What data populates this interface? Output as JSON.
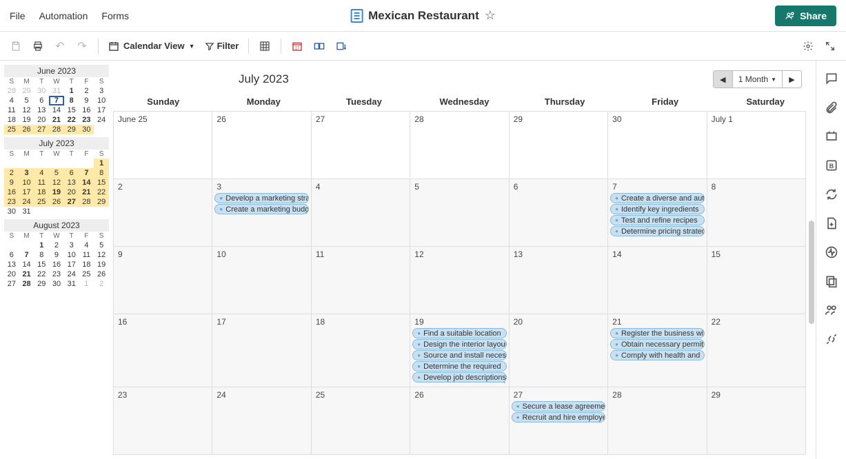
{
  "menu": {
    "file": "File",
    "automation": "Automation",
    "forms": "Forms"
  },
  "doc": {
    "title": "Mexican Restaurant"
  },
  "share": "Share",
  "view": {
    "label": "Calendar View",
    "filter": "Filter"
  },
  "range": {
    "label": "1 Month"
  },
  "monthTitle": "July 2023",
  "weekdays": [
    "Sunday",
    "Monday",
    "Tuesday",
    "Wednesday",
    "Thursday",
    "Friday",
    "Saturday"
  ],
  "cells": [
    {
      "label": "June 25",
      "firstRow": true
    },
    {
      "label": "26",
      "firstRow": true
    },
    {
      "label": "27",
      "firstRow": true
    },
    {
      "label": "28",
      "firstRow": true
    },
    {
      "label": "29",
      "firstRow": true
    },
    {
      "label": "30",
      "firstRow": true
    },
    {
      "label": "July 1",
      "firstRow": true
    },
    {
      "label": "2"
    },
    {
      "label": "3",
      "events": [
        "Develop a marketing strategy",
        "Create a marketing budget"
      ]
    },
    {
      "label": "4"
    },
    {
      "label": "5"
    },
    {
      "label": "6"
    },
    {
      "label": "7",
      "events": [
        "Create a diverse and authentic",
        "Identify key ingredients",
        "Test and refine recipes",
        "Determine pricing strategy"
      ]
    },
    {
      "label": "8"
    },
    {
      "label": "9"
    },
    {
      "label": "10"
    },
    {
      "label": "11"
    },
    {
      "label": "12"
    },
    {
      "label": "13"
    },
    {
      "label": "14"
    },
    {
      "label": "15"
    },
    {
      "label": "16"
    },
    {
      "label": "17"
    },
    {
      "label": "18"
    },
    {
      "label": "19",
      "events": [
        "Find a suitable location",
        "Design the interior layout",
        "Source and install necessary",
        "Determine the required",
        "Develop job descriptions"
      ],
      "more": true
    },
    {
      "label": "20"
    },
    {
      "label": "21",
      "events": [
        "Register the business with",
        "Obtain necessary permits",
        "Comply with health and"
      ]
    },
    {
      "label": "22"
    },
    {
      "label": "23"
    },
    {
      "label": "24"
    },
    {
      "label": "25"
    },
    {
      "label": "26"
    },
    {
      "label": "27",
      "events": [
        "Secure a lease agreement",
        "Recruit and hire employees"
      ]
    },
    {
      "label": "28"
    },
    {
      "label": "29"
    }
  ],
  "mini": [
    {
      "title": "June 2023",
      "days": [
        {
          "n": "28",
          "dim": true
        },
        {
          "n": "29",
          "dim": true
        },
        {
          "n": "30",
          "dim": true
        },
        {
          "n": "31",
          "dim": true
        },
        {
          "n": "1",
          "bold": true
        },
        {
          "n": "2"
        },
        {
          "n": "3"
        },
        {
          "n": "4"
        },
        {
          "n": "5"
        },
        {
          "n": "6"
        },
        {
          "n": "7",
          "sel": true
        },
        {
          "n": "8",
          "bold": true
        },
        {
          "n": "9"
        },
        {
          "n": "10"
        },
        {
          "n": "11"
        },
        {
          "n": "12"
        },
        {
          "n": "13"
        },
        {
          "n": "14"
        },
        {
          "n": "15"
        },
        {
          "n": "16"
        },
        {
          "n": "17"
        },
        {
          "n": "18"
        },
        {
          "n": "19"
        },
        {
          "n": "20"
        },
        {
          "n": "21",
          "bold": true
        },
        {
          "n": "22",
          "bold": true
        },
        {
          "n": "23",
          "bold": true
        },
        {
          "n": "24"
        },
        {
          "n": "25",
          "hl": true
        },
        {
          "n": "26",
          "hl": true
        },
        {
          "n": "27",
          "hl": true
        },
        {
          "n": "28",
          "hl": true
        },
        {
          "n": "29",
          "hl": true
        },
        {
          "n": "30",
          "hl": true
        }
      ]
    },
    {
      "title": "July 2023",
      "days": [
        {
          "n": "",
          "ph": true
        },
        {
          "n": "",
          "ph": true
        },
        {
          "n": "",
          "ph": true
        },
        {
          "n": "",
          "ph": true
        },
        {
          "n": "",
          "ph": true
        },
        {
          "n": "",
          "ph": true
        },
        {
          "n": "1",
          "hl": true,
          "bold": true
        },
        {
          "n": "2",
          "hl": true
        },
        {
          "n": "3",
          "hl": true,
          "bold": true
        },
        {
          "n": "4",
          "hl": true
        },
        {
          "n": "5",
          "hl": true
        },
        {
          "n": "6",
          "hl": true
        },
        {
          "n": "7",
          "hl": true,
          "bold": true
        },
        {
          "n": "8",
          "hl": true
        },
        {
          "n": "9",
          "hl": true
        },
        {
          "n": "10",
          "hl": true
        },
        {
          "n": "11",
          "hl": true
        },
        {
          "n": "12",
          "hl": true
        },
        {
          "n": "13",
          "hl": true
        },
        {
          "n": "14",
          "hl": true,
          "bold": true
        },
        {
          "n": "15",
          "hl": true
        },
        {
          "n": "16",
          "hl": true
        },
        {
          "n": "17",
          "hl": true
        },
        {
          "n": "18",
          "hl": true
        },
        {
          "n": "19",
          "hl": true,
          "bold": true
        },
        {
          "n": "20",
          "hl": true
        },
        {
          "n": "21",
          "hl": true,
          "bold": true
        },
        {
          "n": "22",
          "hl": true
        },
        {
          "n": "23",
          "hl": true
        },
        {
          "n": "24",
          "hl": true
        },
        {
          "n": "25",
          "hl": true
        },
        {
          "n": "26",
          "hl": true
        },
        {
          "n": "27",
          "hl": true,
          "bold": true
        },
        {
          "n": "28",
          "hl": true
        },
        {
          "n": "29",
          "hl": true
        },
        {
          "n": "30"
        },
        {
          "n": "31"
        }
      ]
    },
    {
      "title": "August 2023",
      "days": [
        {
          "n": "",
          "ph": true
        },
        {
          "n": "",
          "ph": true
        },
        {
          "n": "1",
          "bold": true
        },
        {
          "n": "2"
        },
        {
          "n": "3"
        },
        {
          "n": "4"
        },
        {
          "n": "5"
        },
        {
          "n": "6"
        },
        {
          "n": "7",
          "bold": true
        },
        {
          "n": "8"
        },
        {
          "n": "9"
        },
        {
          "n": "10"
        },
        {
          "n": "11"
        },
        {
          "n": "12"
        },
        {
          "n": "13"
        },
        {
          "n": "14"
        },
        {
          "n": "15"
        },
        {
          "n": "16"
        },
        {
          "n": "17"
        },
        {
          "n": "18"
        },
        {
          "n": "19"
        },
        {
          "n": "20"
        },
        {
          "n": "21",
          "bold": true
        },
        {
          "n": "22"
        },
        {
          "n": "23"
        },
        {
          "n": "24"
        },
        {
          "n": "25"
        },
        {
          "n": "26"
        },
        {
          "n": "27"
        },
        {
          "n": "28",
          "bold": true
        },
        {
          "n": "29"
        },
        {
          "n": "30"
        },
        {
          "n": "31"
        },
        {
          "n": "1",
          "dim": true
        },
        {
          "n": "2",
          "dim": true
        }
      ]
    }
  ],
  "miniWeekdays": [
    "S",
    "M",
    "T",
    "W",
    "T",
    "F",
    "S"
  ]
}
